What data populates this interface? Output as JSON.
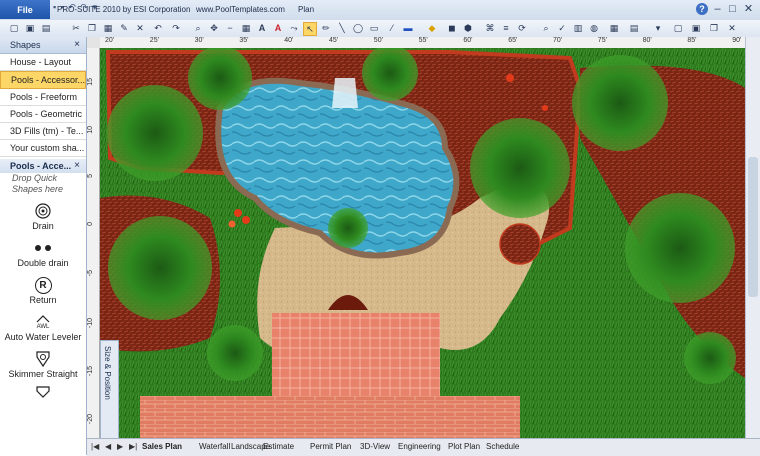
{
  "titlebar": {
    "file_label": "File",
    "app_title": "PRO-SUITE 2010 by ESI Corporation",
    "website": "www.PoolTemplates.com",
    "view": "Plan",
    "help_label": "?",
    "minimize": "–",
    "maximize": "□",
    "close": "✕"
  },
  "toolbar": {
    "text_tool": "A",
    "font_label": "A"
  },
  "shapes_panel": {
    "title": "Shapes",
    "close": "×",
    "categories": [
      {
        "label": "House - Layout"
      },
      {
        "label": "Pools - Accessor..."
      },
      {
        "label": "Pools - Freeform"
      },
      {
        "label": "Pools - Geometric"
      },
      {
        "label": "3D Fills (tm) - Te..."
      },
      {
        "label": "Your custom sha..."
      }
    ],
    "section_title": "Pools - Acce...",
    "section_close": "×",
    "drop_hint": "Drop Quick Shapes here",
    "items": [
      {
        "label": "Drain"
      },
      {
        "label": "Double drain"
      },
      {
        "label": "Return",
        "glyph": "R"
      },
      {
        "label": "Auto Water Leveler",
        "glyph": "AWL"
      },
      {
        "label": "Skimmer Straight"
      }
    ]
  },
  "ruler": {
    "top": [
      "20'",
      "25'",
      "30'",
      "35'",
      "40'",
      "45'",
      "50'",
      "55'",
      "60'",
      "65'",
      "70'",
      "75'",
      "80'",
      "85'",
      "90'"
    ],
    "left": [
      "15",
      "10",
      "5",
      "0",
      "-5",
      "-10",
      "-15",
      "-20"
    ]
  },
  "size_position_label": "Size & Position",
  "tabs": [
    "Sales Plan",
    "Waterfall",
    "Landscape",
    "Estimate",
    "Permit Plan",
    "3D-View",
    "Engineering",
    "Plot Plan",
    "Schedule"
  ],
  "tab_nav": [
    "|◀",
    "◀",
    "▶",
    "▶|"
  ],
  "colors": {
    "grass": "#2f7a1f",
    "water": "#3fa7c9",
    "deck": "#d6b98a",
    "mulch": "#8b2a16",
    "brick": "#e8826a",
    "accent": "#1f55a9"
  }
}
